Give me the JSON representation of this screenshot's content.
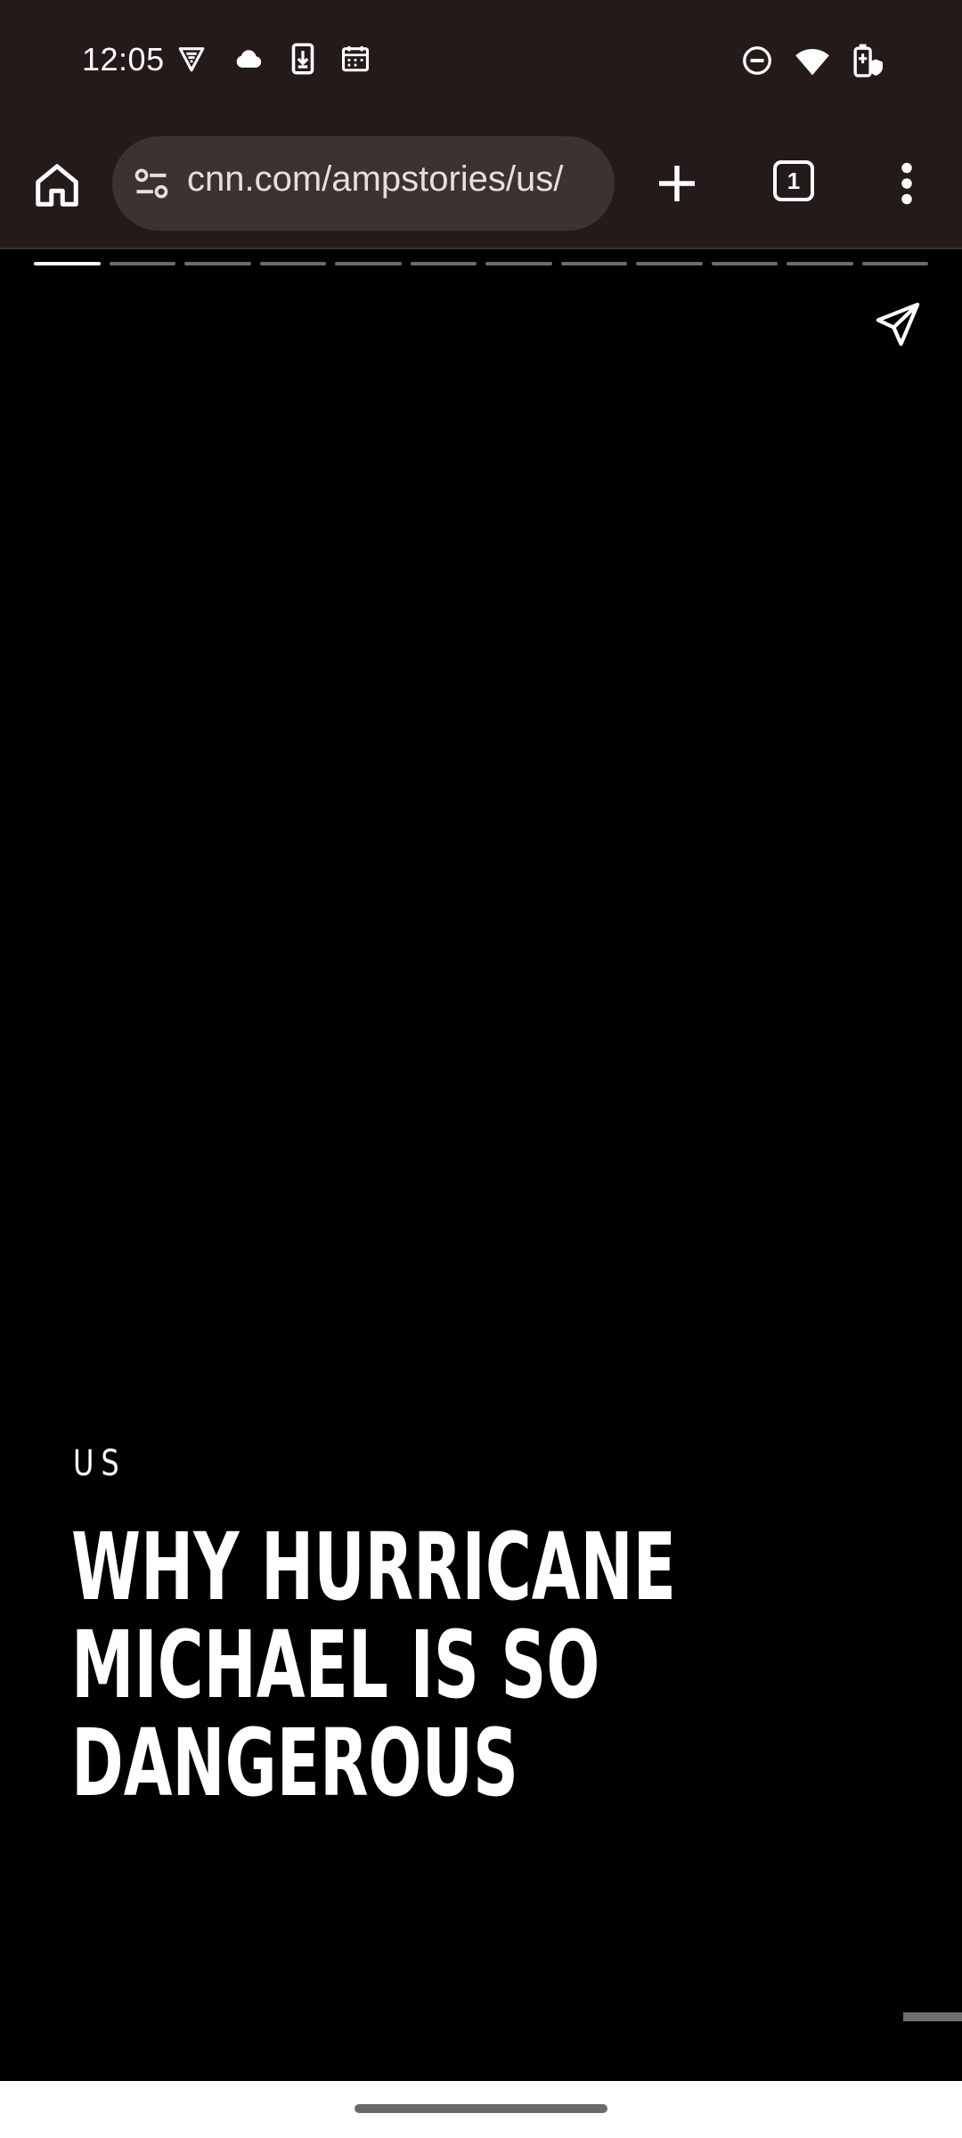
{
  "status_bar": {
    "time": "12:05",
    "left_icons": [
      "vpn-shield-icon",
      "cloud-icon",
      "download-icon",
      "calendar-icon"
    ],
    "right_icons": [
      "do-not-disturb-icon",
      "wifi-icon",
      "battery-saver-icon"
    ]
  },
  "browser": {
    "url": "cnn.com/ampstories/us/",
    "tab_count": "1"
  },
  "story": {
    "section": "US",
    "headline_lines": [
      "WHY HURRICANE",
      "MICHAEL IS SO",
      "DANGEROUS"
    ],
    "progress": {
      "total_pages": 12,
      "current_page": 1
    }
  },
  "colors": {
    "chrome_background": "#241a19",
    "url_bar_background": "#3c3230",
    "story_background": "#000000",
    "text": "#ffffff"
  }
}
